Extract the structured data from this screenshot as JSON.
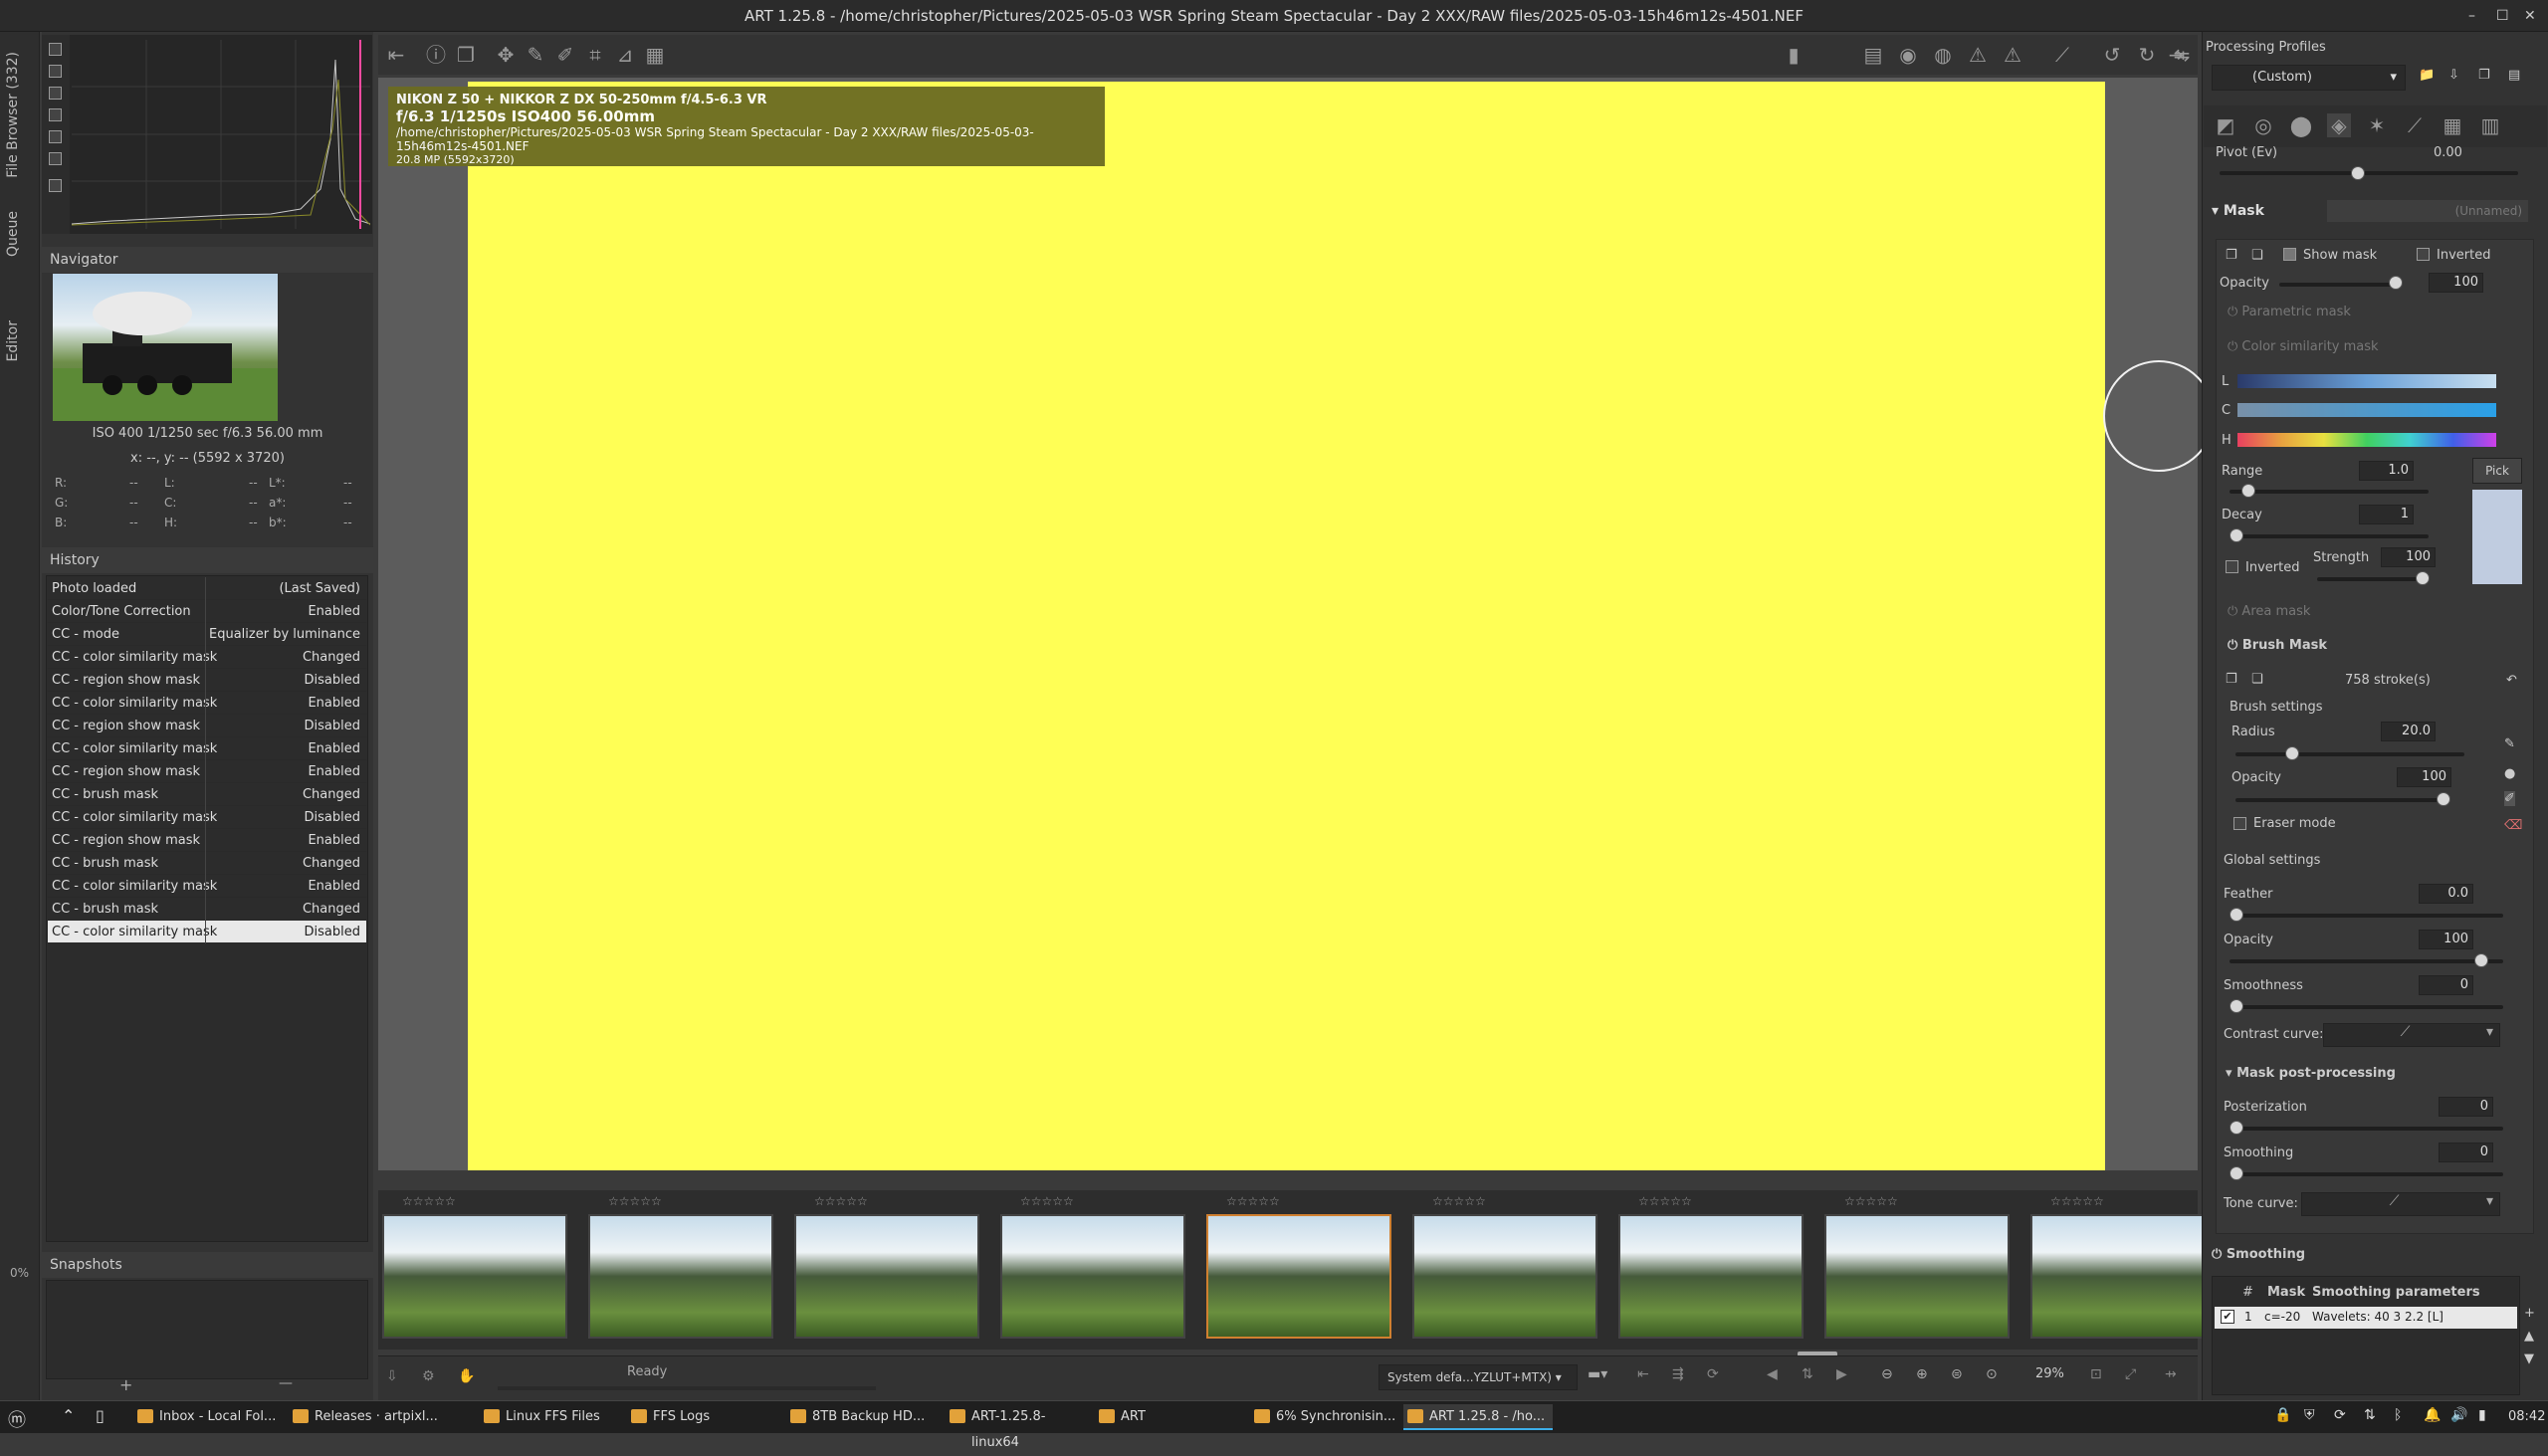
{
  "window": {
    "title": "ART 1.25.8 - /home/christopher/Pictures/2025-05-03 WSR Spring Steam Spectacular - Day 2 XXX/RAW files/2025-05-03-15h46m12s-4501.NEF"
  },
  "left_tabs": {
    "file_browser": "File Browser (332)",
    "queue": "Queue",
    "editor": "Editor"
  },
  "navigator": {
    "title": "Navigator",
    "exif": "ISO 400   1/1250 sec   f/6.3   56.00 mm",
    "coords": "x: --, y: --    (5592 x 3720)",
    "readout": [
      {
        "a": "R:",
        "av": "--",
        "b": "L:",
        "bv": "--",
        "c": "L*:",
        "cv": "--"
      },
      {
        "a": "G:",
        "av": "--",
        "b": "C:",
        "bv": "--",
        "c": "a*:",
        "cv": "--"
      },
      {
        "a": "B:",
        "av": "--",
        "b": "H:",
        "bv": "--",
        "c": "b*:",
        "cv": "--"
      }
    ]
  },
  "history": {
    "title": "History",
    "rows": [
      {
        "name": "Photo loaded",
        "val": "(Last Saved)"
      },
      {
        "name": "Color/Tone Correction",
        "val": "Enabled"
      },
      {
        "name": "CC - mode",
        "val": "Equalizer by luminance"
      },
      {
        "name": "CC - color similarity mask",
        "val": "Changed"
      },
      {
        "name": "CC - region show mask",
        "val": "Disabled"
      },
      {
        "name": "CC - color similarity mask",
        "val": "Enabled"
      },
      {
        "name": "CC - region show mask",
        "val": "Disabled"
      },
      {
        "name": "CC - color similarity mask",
        "val": "Enabled"
      },
      {
        "name": "CC - region show mask",
        "val": "Enabled"
      },
      {
        "name": "CC - brush mask",
        "val": "Changed"
      },
      {
        "name": "CC - color similarity mask",
        "val": "Disabled"
      },
      {
        "name": "CC - region show mask",
        "val": "Enabled"
      },
      {
        "name": "CC - brush mask",
        "val": "Changed"
      },
      {
        "name": "CC - color similarity mask",
        "val": "Enabled"
      },
      {
        "name": "CC - brush mask",
        "val": "Changed"
      },
      {
        "name": "CC - color similarity mask",
        "val": "Disabled"
      }
    ]
  },
  "snapshots": {
    "title": "Snapshots",
    "add": "+",
    "remove": "—"
  },
  "left_percent": "0%",
  "info_overlay": {
    "line1": "NIKON Z 50 + NIKKOR Z DX 50-250mm f/4.5-6.3 VR",
    "line2": "f/6.3  1/1250s  ISO400  56.00mm",
    "line3": "/home/christopher/Pictures/2025-05-03 WSR Spring Steam Spectacular - Day 2 XXX/RAW files/2025-05-03-15h46m12s-4501.NEF",
    "line4": "20.8 MP (5592x3720)"
  },
  "statusbar": {
    "ready": "Ready",
    "profile": "System defa...YZLUT+MTX)",
    "zoom": "29%"
  },
  "right": {
    "profiles_title": "Processing Profiles",
    "profile_value": "(Custom)",
    "pivot_label": "Pivot (Ev)",
    "pivot_value": "0.00",
    "mask_title": "Mask",
    "mask_name": "(Unnamed)",
    "show_mask": "Show mask",
    "inverted": "Inverted",
    "opacity_label": "Opacity",
    "opacity_value": "100",
    "parametric_mask": "Parametric mask",
    "color_similarity_mask": "Color similarity mask",
    "ch_l": "L",
    "ch_c": "C",
    "ch_h": "H",
    "range_label": "Range",
    "range_value": "1.0",
    "pick": "Pick",
    "decay_label": "Decay",
    "decay_value": "1",
    "inverted2": "Inverted",
    "strength_label": "Strength",
    "strength_value": "100",
    "area_mask": "Area mask",
    "brush_mask": "Brush Mask",
    "strokes": "758 stroke(s)",
    "brush_settings": "Brush settings",
    "radius_label": "Radius",
    "radius_value": "20.0",
    "bopacity_label": "Opacity",
    "bopacity_value": "100",
    "eraser": "Eraser mode",
    "global_settings": "Global settings",
    "feather_label": "Feather",
    "feather_value": "0.0",
    "gopacity_label": "Opacity",
    "gopacity_value": "100",
    "smoothness_label": "Smoothness",
    "smoothness_value": "0",
    "contrast_curve": "Contrast curve:",
    "mask_post": "Mask post-processing",
    "posterization_label": "Posterization",
    "posterization_value": "0",
    "smoothing_label": "Smoothing",
    "smoothing_value": "0",
    "tone_curve": "Tone curve:",
    "smoothing_title": "Smoothing",
    "table_hash": "#",
    "table_mask": "Mask",
    "table_params": "Smoothing parameters",
    "row_num": "1",
    "row_mask": "c=-20",
    "row_params": "Wavelets: 40 3 2.2 [L]"
  },
  "taskbar": {
    "items": [
      "Inbox - Local Fol...",
      "Releases · artpixl...",
      "Linux FFS Files",
      "FFS Logs",
      "8TB Backup HD...",
      "ART-1.25.8-linux64",
      "ART",
      "6% Synchronisin...",
      "ART 1.25.8 - /ho..."
    ],
    "clock": "08:42"
  }
}
